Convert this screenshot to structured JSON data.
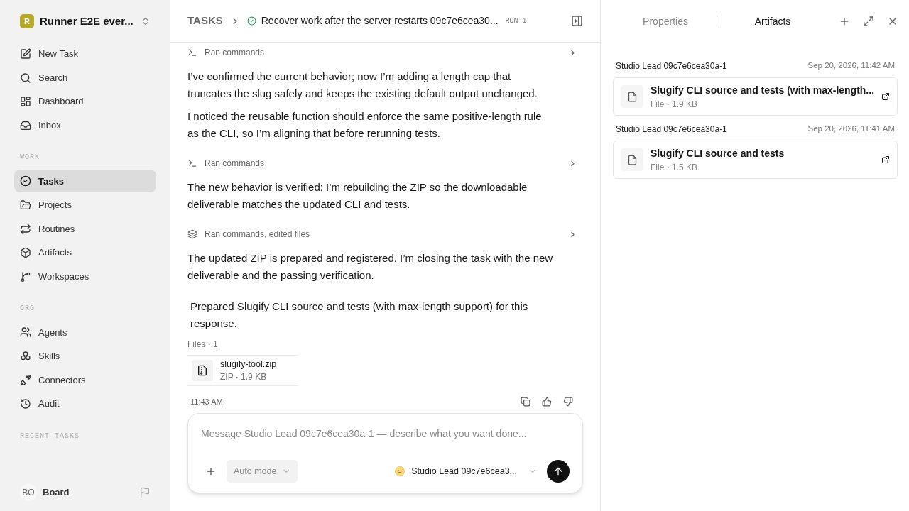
{
  "workspace": {
    "initial": "R",
    "name": "Runner E2E ever..."
  },
  "nav": [
    {
      "items": [
        {
          "label": "New Task",
          "selected": false
        },
        {
          "label": "Search",
          "selected": false
        },
        {
          "label": "Dashboard",
          "selected": false
        },
        {
          "label": "Inbox",
          "selected": false
        }
      ]
    },
    {
      "label": "WORK",
      "items": [
        {
          "label": "Tasks",
          "selected": true
        },
        {
          "label": "Projects",
          "selected": false
        },
        {
          "label": "Routines",
          "selected": false
        },
        {
          "label": "Artifacts",
          "selected": false
        },
        {
          "label": "Workspaces",
          "selected": false
        }
      ]
    },
    {
      "label": "ORG",
      "items": [
        {
          "label": "Agents",
          "selected": false
        },
        {
          "label": "Skills",
          "selected": false
        },
        {
          "label": "Connectors",
          "selected": false
        },
        {
          "label": "Audit",
          "selected": false
        }
      ]
    },
    {
      "label": "RECENT TASKS"
    }
  ],
  "user": {
    "initials": "BO",
    "name": "Board"
  },
  "header": {
    "crumb": "TASKS",
    "title": "Recover work after the server restarts 09c7e6cea30...",
    "run": "RUN-1"
  },
  "feed": [
    {
      "kind": "step",
      "label": "Ran commands"
    },
    {
      "kind": "message",
      "text": "I’ve confirmed the current behavior; now I’m adding a length cap that truncates the slug safely and keeps the existing default output unchanged."
    },
    {
      "kind": "message",
      "text": "I noticed the reusable function should enforce the same positive-length rule as the CLI, so I’m aligning that before rerunning tests."
    },
    {
      "kind": "step",
      "label": "Ran commands"
    },
    {
      "kind": "message",
      "text": "The new behavior is verified; I’m rebuilding the ZIP so the downloadable deliverable matches the updated CLI and tests."
    },
    {
      "kind": "edit",
      "label": "Ran commands, edited files"
    },
    {
      "kind": "message",
      "text": "The updated ZIP is prepared and registered. I’m closing the task with the new deliverable and the passing verification."
    }
  ],
  "summary": "Prepared Slugify CLI source and tests (with max-length support) for this response.",
  "files_label": "Files · 1",
  "files": [
    {
      "name": "slugify-tool.zip",
      "meta": "ZIP · 1.9 KB"
    }
  ],
  "time": "11:43 AM",
  "composer": {
    "placeholder": "Message Studio Lead 09c7e6cea30a-1 — describe what you want done...",
    "mode": "Auto mode",
    "agent": "Studio Lead 09c7e6cea3..."
  },
  "panel": {
    "tabs": [
      {
        "label": "Properties",
        "selected": false
      },
      {
        "label": "Artifacts",
        "selected": true
      }
    ],
    "groups": [
      {
        "author": "Studio Lead 09c7e6cea30a-1",
        "date": "Sep 20, 2026, 11:42 AM",
        "title": "Slugify CLI source and tests (with max-length...",
        "meta": "File · 1.9 KB"
      },
      {
        "author": "Studio Lead 09c7e6cea30a-1",
        "date": "Sep 20, 2026, 11:41 AM",
        "title": "Slugify CLI source and tests",
        "meta": "File · 1.5 KB"
      }
    ]
  }
}
